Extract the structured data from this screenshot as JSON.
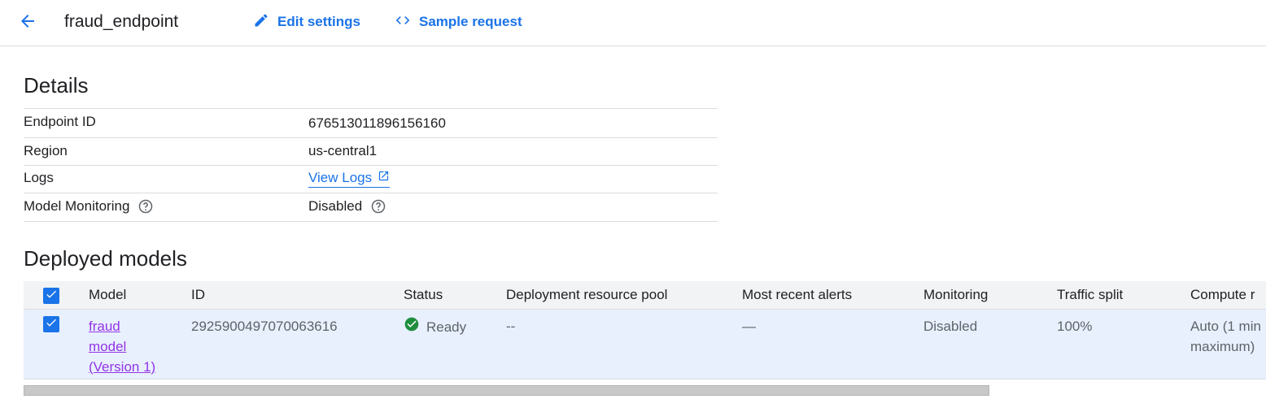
{
  "header": {
    "title": "fraud_endpoint",
    "edit_settings": "Edit settings",
    "sample_request": "Sample request"
  },
  "details": {
    "title": "Details",
    "rows": [
      {
        "key": "Endpoint ID",
        "value": "676513011896156160"
      },
      {
        "key": "Region",
        "value": "us-central1"
      },
      {
        "key": "Logs",
        "value": "View Logs"
      },
      {
        "key": "Model Monitoring",
        "value": "Disabled"
      }
    ]
  },
  "deployed": {
    "title": "Deployed models",
    "columns": [
      "Model",
      "ID",
      "Status",
      "Deployment resource pool",
      "Most recent alerts",
      "Monitoring",
      "Traffic split",
      "Compute r"
    ],
    "row": {
      "model_line1": "fraud",
      "model_line2": "model",
      "model_line3": "(Version 1)",
      "id": "2925900497070063616",
      "status": "Ready",
      "pool": "--",
      "alerts": "—",
      "monitoring": "Disabled",
      "traffic": "100%",
      "compute_line1": "Auto (1 min",
      "compute_line2": "maximum)"
    }
  },
  "colors": {
    "accent": "#1a73e8",
    "ready": "#1e8e3e",
    "visited_link": "#9334e6",
    "selected_row": "#e8f0fe"
  }
}
